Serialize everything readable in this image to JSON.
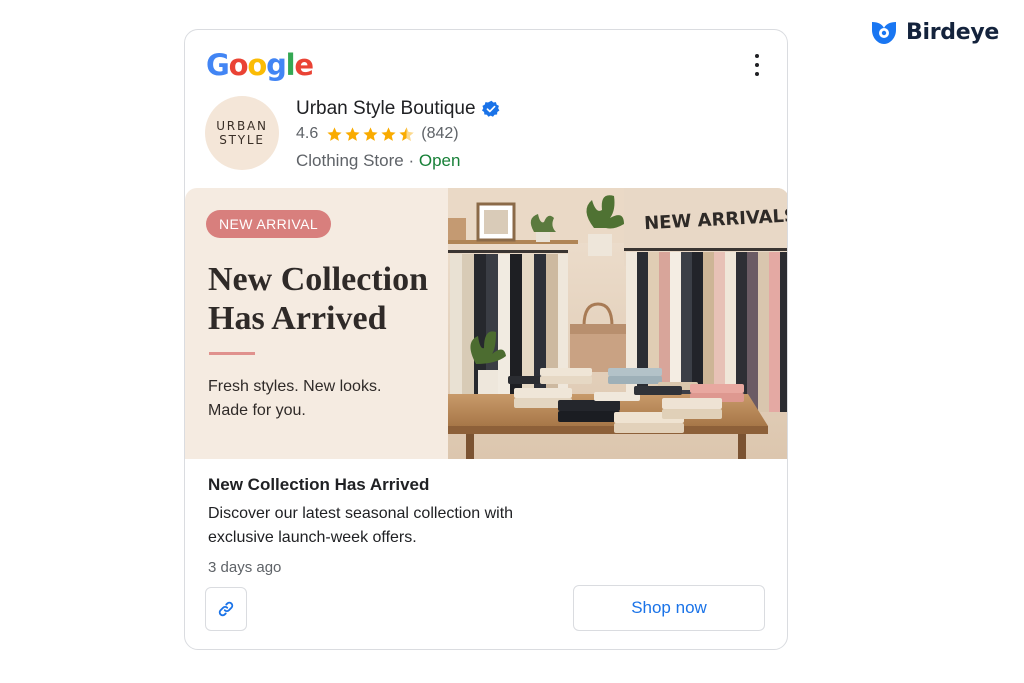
{
  "brand": {
    "name": "Birdeye",
    "logo_icon": "birdeye-logo-icon",
    "color": "#1976f2"
  },
  "card": {
    "logo": {
      "g1": "G",
      "o1": "o",
      "o2": "o",
      "g2": "g",
      "l": "l",
      "e": "e"
    },
    "menu_icon": "kebab-menu-icon",
    "business": {
      "avatar_line1": "URBAN",
      "avatar_line2": "STYLE",
      "name": "Urban Style Boutique",
      "verified_icon": "verified-badge-icon",
      "rating": "4.6",
      "stars": 4.5,
      "review_count": "(842)",
      "category": "Clothing Store",
      "separator": " · ",
      "status": "Open",
      "status_color": "#188038"
    },
    "banner": {
      "badge": "NEW ARRIVAL",
      "headline": "New Collection Has Arrived",
      "tagline_1": "Fresh styles. New looks.",
      "tagline_2": "Made for you.",
      "photo_sign": "NEW ARRIVALS",
      "accent": "#d87f7d"
    },
    "post": {
      "title": "New Collection Has Arrived",
      "description": "Discover our latest seasonal collection with exclusive launch-week offers.",
      "time": "3 days ago"
    },
    "actions": {
      "link_icon": "link-icon",
      "shop_label": "Shop now",
      "shop_color": "#1a73e8"
    }
  }
}
